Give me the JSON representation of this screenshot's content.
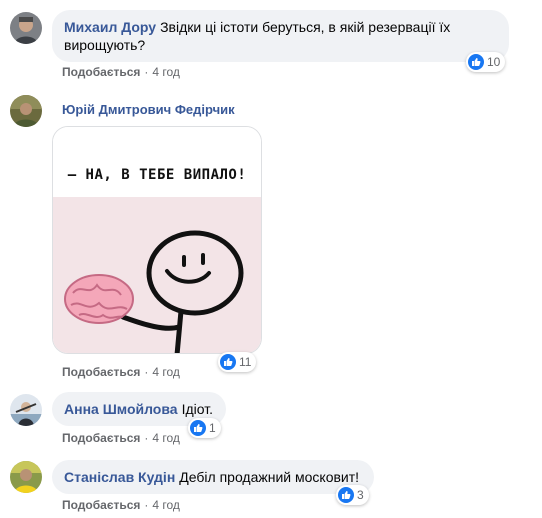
{
  "comments": [
    {
      "author": "Михаил Дору",
      "text": "Звідки ці істоти беруться, в якій резервації їх вирощують?",
      "like_label": "Подобається",
      "time": "4 год",
      "reaction_count": "10"
    },
    {
      "author": "Юрій Дмитрович Федірчик",
      "image_caption": "— НА, В ТЕБЕ ВИПАЛО!",
      "like_label": "Подобається",
      "time": "4 год",
      "reaction_count": "11"
    },
    {
      "author": "Анна Шмойлова",
      "text": "Ідіот.",
      "like_label": "Подобається",
      "time": "4 год",
      "reaction_count": "1"
    },
    {
      "author": "Станіслав Кудін",
      "text": "Дебіл продажний московит!",
      "like_label": "Подобається",
      "time": "4 год",
      "reaction_count": "3"
    }
  ],
  "separator": "·",
  "colors": {
    "author": "#385898",
    "bubble": "#f0f2f5",
    "like_blue": "#1877f2",
    "meta": "#65676b"
  }
}
